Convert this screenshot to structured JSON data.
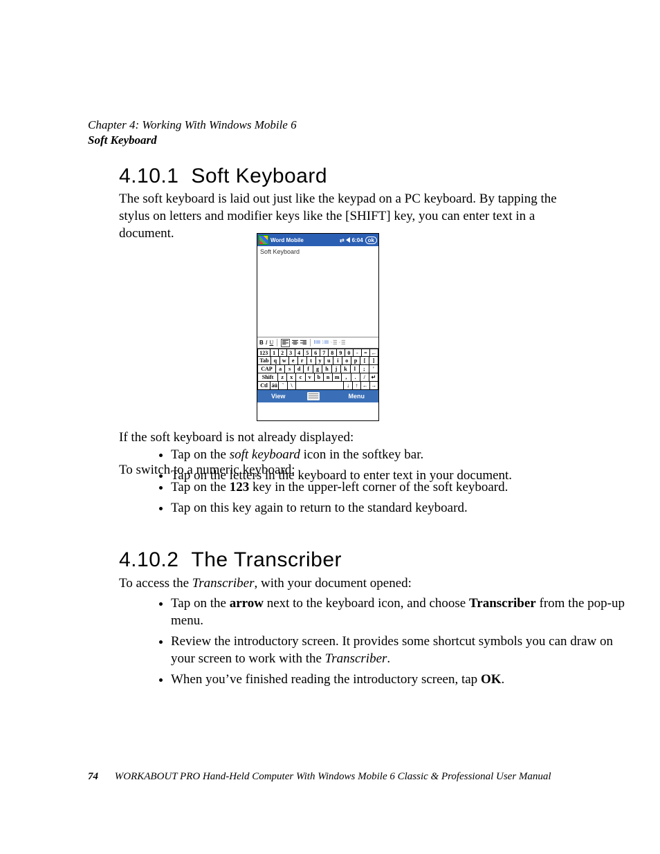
{
  "header": {
    "chapter_line": "Chapter  4:  Working With Windows Mobile 6",
    "section_line": "Soft Keyboard"
  },
  "section1": {
    "number": "4.10.1",
    "title": "Soft Keyboard",
    "intro": "The soft keyboard is laid out just like the keypad on a PC keyboard. By tapping the stylus on letters and modifier keys like the [SHIFT] key, you can enter text in a document.",
    "after_shot": "If the soft keyboard is not already displayed:",
    "bullets_a": [
      {
        "pre": "Tap on the ",
        "em": "soft keyboard",
        "post": " icon in the softkey bar."
      },
      {
        "pre": "Tap on the letters in the keyboard to enter text in your document.",
        "em": "",
        "post": ""
      }
    ],
    "switch_line": "To switch to a numeric keyboard:",
    "bullets_b": [
      {
        "pre": "Tap on the ",
        "b": "123",
        "post": " key in the upper-left corner of the soft keyboard."
      },
      {
        "pre": "Tap on this key again to return to the standard keyboard.",
        "b": "",
        "post": ""
      }
    ]
  },
  "section2": {
    "number": "4.10.2",
    "title": "The Transcriber",
    "intro_pre": "To access the ",
    "intro_em": "Transcriber",
    "intro_post": ", with your document opened:",
    "bullets": [
      {
        "html": "Tap on the <b>arrow</b> next to the keyboard icon, and choose <b>Transcriber</b> from the pop-up menu."
      },
      {
        "html": "Review the introductory screen. It provides some shortcut symbols you can draw on your screen to work with the <i>Transcriber</i>."
      },
      {
        "html": "When you’ve finished reading the introductory screen, tap <b>OK</b>."
      }
    ]
  },
  "footer": {
    "page": "74",
    "text": "WORKABOUT PRO Hand-Held Computer With Windows Mobile 6 Classic & Professional User Manual"
  },
  "screenshot": {
    "title": "Word Mobile",
    "time": "6:04",
    "ok": "ok",
    "doc_label": "Soft Keyboard",
    "fmt": {
      "b": "B",
      "i": "I",
      "u": "U"
    },
    "keyboard": {
      "row1": [
        "123",
        "1",
        "2",
        "3",
        "4",
        "5",
        "6",
        "7",
        "8",
        "9",
        "0",
        "-",
        "=",
        "←"
      ],
      "row2": [
        "Tab",
        "q",
        "w",
        "e",
        "r",
        "t",
        "y",
        "u",
        "i",
        "o",
        "p",
        "[",
        "]"
      ],
      "row3": [
        "CAP",
        "a",
        "s",
        "d",
        "f",
        "g",
        "h",
        "j",
        "k",
        "l",
        ";",
        "'"
      ],
      "row4": [
        "Shift",
        "z",
        "x",
        "c",
        "v",
        "b",
        "n",
        "m",
        ",",
        ".",
        "/",
        "↵"
      ],
      "row5": [
        "Ctl",
        "áü",
        "`",
        "\\",
        " ",
        "↓",
        "↑",
        "←",
        "→"
      ]
    },
    "softkeys": {
      "left": "View",
      "right": "Menu"
    }
  }
}
